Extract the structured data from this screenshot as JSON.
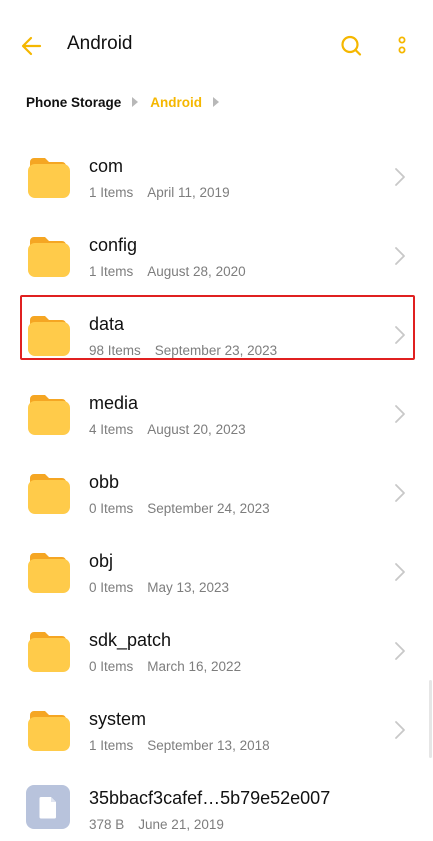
{
  "header": {
    "title": "Android"
  },
  "colors": {
    "accent": "#F5B700",
    "folder": "#FFCB4A",
    "folder_tab": "#F5A623",
    "highlight": "#E02020",
    "file_icon": "#B8C3DC"
  },
  "breadcrumb": {
    "items": [
      "Phone Storage",
      "Android"
    ]
  },
  "rows": [
    {
      "name": "com",
      "count": "1 Items",
      "date": "April 11, 2019",
      "icon": "folder-icon"
    },
    {
      "name": "config",
      "count": "1 Items",
      "date": "August 28, 2020",
      "icon": "folder-icon"
    },
    {
      "name": "data",
      "count": "98 Items",
      "date": "September 23, 2023",
      "icon": "folder-icon",
      "highlighted": true
    },
    {
      "name": "media",
      "count": "4 Items",
      "date": "August 20, 2023",
      "icon": "folder-icon"
    },
    {
      "name": "obb",
      "count": "0 Items",
      "date": "September 24, 2023",
      "icon": "folder-icon"
    },
    {
      "name": "obj",
      "count": "0 Items",
      "date": "May 13, 2023",
      "icon": "folder-icon"
    },
    {
      "name": "sdk_patch",
      "count": "0 Items",
      "date": "March 16, 2022",
      "icon": "folder-icon"
    },
    {
      "name": "system",
      "count": "1 Items",
      "date": "September 13, 2018",
      "icon": "folder-icon"
    },
    {
      "name": "35bbacf3cafef…5b79e52e007",
      "count": "378 B",
      "date": "June 21, 2019",
      "icon": "file-icon"
    }
  ]
}
